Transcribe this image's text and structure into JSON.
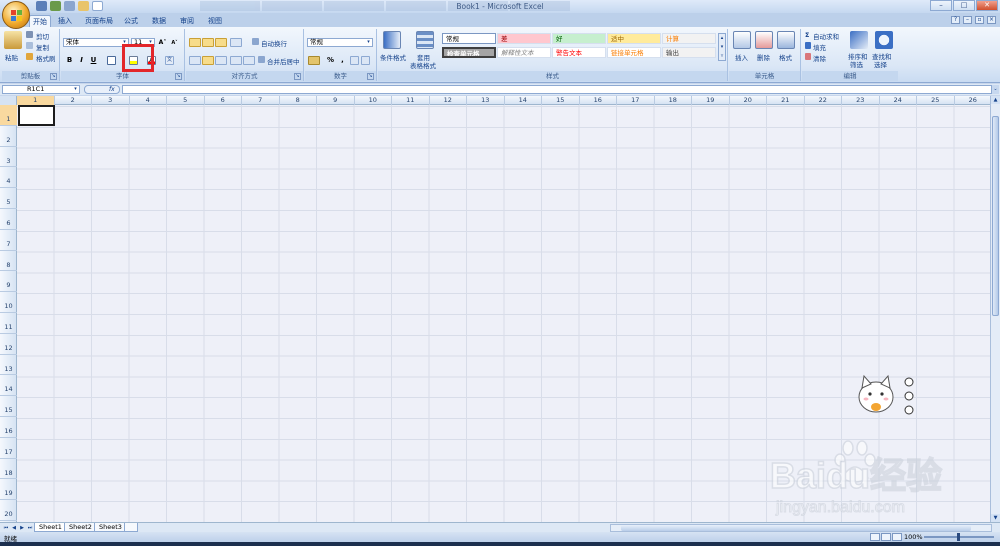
{
  "window": {
    "title": "Book1 - Microsoft Excel"
  },
  "ribbon_tabs": [
    "开始",
    "插入",
    "页面布局",
    "公式",
    "数据",
    "审阅",
    "视图"
  ],
  "clipboard": {
    "paste": "粘贴",
    "cut": "剪切",
    "copy": "复制",
    "format_painter": "格式刷",
    "group_label": "剪贴板"
  },
  "font": {
    "font_name": "宋体",
    "font_size": "11",
    "bold": "B",
    "italic": "I",
    "underline": "U",
    "group_label": "字体"
  },
  "alignment": {
    "wrap_text": "自动换行",
    "merge_center": "合并后居中",
    "group_label": "对齐方式"
  },
  "number": {
    "format": "常规",
    "percent": "%",
    "comma": ",",
    "group_label": "数字"
  },
  "styles": {
    "conditional_format": "条件格式",
    "table_format_1": "套用",
    "table_format_2": "表格格式",
    "cell_styles": [
      {
        "label": "常规",
        "bg": "#ffffff",
        "color": "#000000"
      },
      {
        "label": "差",
        "bg": "#ffc7ce",
        "color": "#9c0006"
      },
      {
        "label": "好",
        "bg": "#c6efce",
        "color": "#006100"
      },
      {
        "label": "适中",
        "bg": "#ffeb9c",
        "color": "#9c6500"
      },
      {
        "label": "计算",
        "bg": "#f2f2f2",
        "color": "#fa7d00"
      },
      {
        "label": "检查单元格",
        "bg": "#a5a5a5",
        "color": "#ffffff"
      },
      {
        "label": "解释性文本",
        "bg": "#ffffff",
        "color": "#7f7f7f"
      },
      {
        "label": "警告文本",
        "bg": "#ffffff",
        "color": "#ff0000"
      },
      {
        "label": "链接单元格",
        "bg": "#ffffff",
        "color": "#fa7d00"
      },
      {
        "label": "输出",
        "bg": "#f2f2f2",
        "color": "#3f3f3f"
      }
    ],
    "group_label": "样式"
  },
  "cells_group": {
    "insert": "插入",
    "delete": "删除",
    "format": "格式",
    "group_label": "单元格"
  },
  "editing": {
    "autosum": "自动求和",
    "fill": "填充",
    "clear": "清除",
    "sort_filter_1": "排序和",
    "sort_filter_2": "筛选",
    "find_select_1": "查找和",
    "find_select_2": "选择",
    "group_label": "编辑"
  },
  "formula_bar": {
    "name_box": "R1C1",
    "fx": "fx",
    "value": ""
  },
  "columns": [
    "1",
    "2",
    "3",
    "4",
    "5",
    "6",
    "7",
    "8",
    "9",
    "10",
    "11",
    "12",
    "13",
    "14",
    "15",
    "16",
    "17",
    "18",
    "19",
    "20",
    "21",
    "22",
    "23",
    "24",
    "25",
    "26"
  ],
  "rows": [
    "1",
    "2",
    "3",
    "4",
    "5",
    "6",
    "7",
    "8",
    "9",
    "10",
    "11",
    "12",
    "13",
    "14",
    "15",
    "16",
    "17",
    "18",
    "19",
    "20"
  ],
  "sheets": [
    "Sheet1",
    "Sheet2",
    "Sheet3"
  ],
  "status": {
    "ready": "就绪",
    "zoom": "100%"
  },
  "watermark": {
    "brand": "Baidu经验",
    "url": "jingyan.baidu.com"
  },
  "colors": {
    "accent": "#15428b",
    "highlight_box": "#e3262a",
    "ribbon_bg": "#dbe7f6"
  }
}
